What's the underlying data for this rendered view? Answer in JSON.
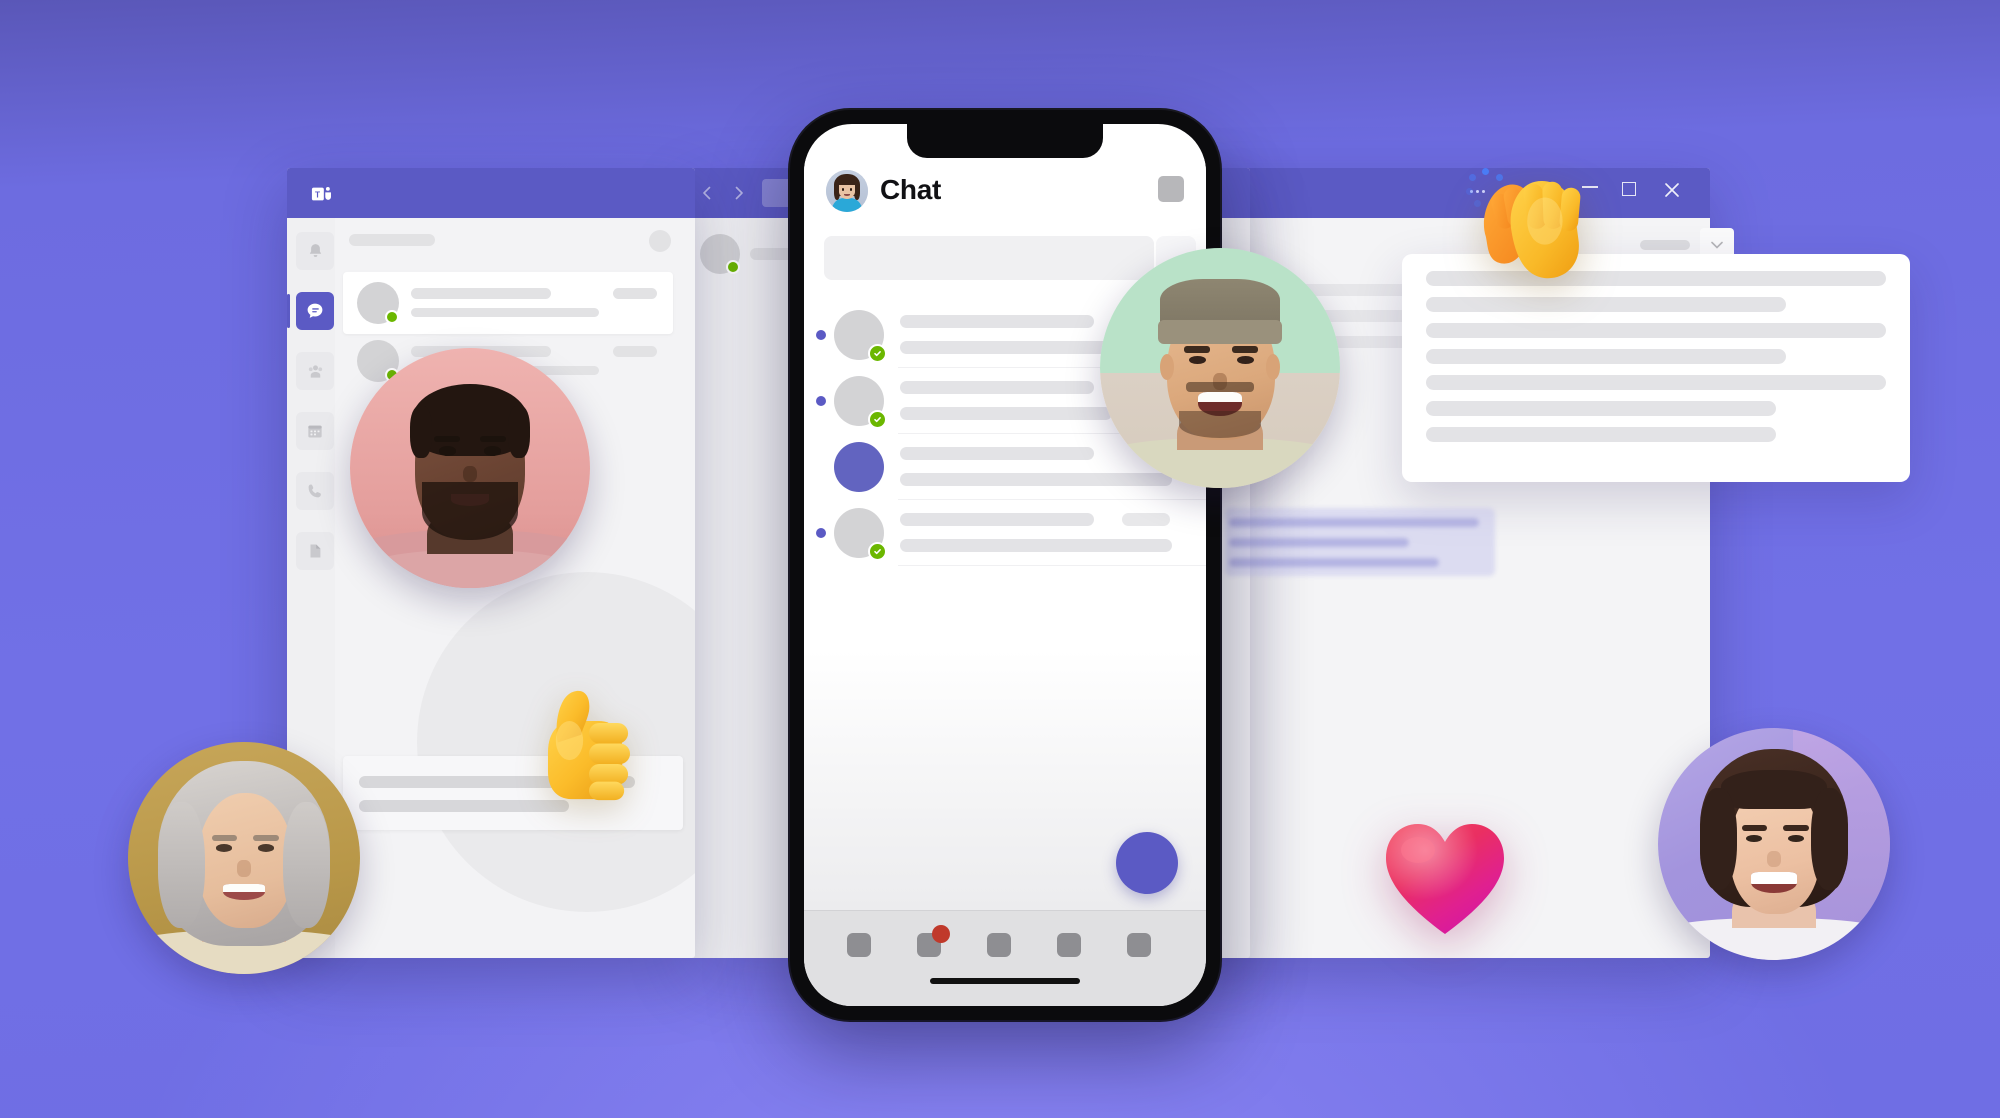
{
  "meta": {
    "scene_title": "Microsoft Teams chat across desktop and mobile",
    "background_color_top": "#5a57b8",
    "background_color_main": "#7170e6",
    "accent_purple": "#5b5ac4",
    "presence_green": "#6bb700",
    "badge_red": "#c0392b"
  },
  "desktop_window": {
    "titlebar": {
      "app_logo_name": "microsoft-teams-logo",
      "back_label": "‹",
      "forward_label": "›",
      "search_placeholder": "",
      "more_options_label": "···",
      "minimize_label": "—",
      "maximize_label": "□",
      "close_label": "✕"
    },
    "app_rail": [
      {
        "name": "activity",
        "icon": "bell-icon",
        "active": false
      },
      {
        "name": "chat",
        "icon": "chat-icon",
        "active": true
      },
      {
        "name": "teams",
        "icon": "people-icon",
        "active": false
      },
      {
        "name": "calendar",
        "icon": "calendar-icon",
        "active": false
      },
      {
        "name": "calls",
        "icon": "phone-icon",
        "active": false
      },
      {
        "name": "files",
        "icon": "file-icon",
        "active": false
      }
    ],
    "chat_list": [
      {
        "selected": true,
        "presence": "available",
        "has_timestamp": true
      },
      {
        "selected": false,
        "presence": "available",
        "has_timestamp": true
      },
      {
        "selected": false,
        "presence": "available",
        "has_timestamp": false
      }
    ]
  },
  "second_window": {
    "header_presence": "available"
  },
  "right_window": {
    "card_lines": [
      460,
      360,
      460,
      360,
      460,
      350,
      350
    ]
  },
  "phone": {
    "header": {
      "avatar_name": "profile-avatar",
      "title": "Chat",
      "action_icon": "new-chat-icon"
    },
    "search": {
      "placeholder": "",
      "filter_icon": "filter-icon"
    },
    "chat_list": [
      {
        "unread": true,
        "presence": "available",
        "avatar_style": "grey",
        "timestamp": false
      },
      {
        "unread": true,
        "presence": "available",
        "avatar_style": "grey",
        "timestamp": false
      },
      {
        "unread": false,
        "presence": "none",
        "avatar_style": "accent",
        "timestamp": false
      },
      {
        "unread": true,
        "presence": "available",
        "avatar_style": "grey",
        "timestamp": true
      }
    ],
    "fab": {
      "name": "new-chat-fab"
    },
    "tabbar": [
      {
        "name": "activity-tab",
        "badge": null
      },
      {
        "name": "chat-tab",
        "badge": "unread"
      },
      {
        "name": "teams-tab",
        "badge": null
      },
      {
        "name": "calendar-tab",
        "badge": null
      },
      {
        "name": "more-tab",
        "badge": null
      }
    ],
    "home_indicator": true
  },
  "people": [
    {
      "id": "person-man-pink",
      "description": "Smiling man in pink sweater",
      "bg": "#e8a6a4"
    },
    {
      "id": "person-man-beanie",
      "description": "Smiling man wearing a beanie hat",
      "bg": "#bfe3cc"
    },
    {
      "id": "person-senior-woman",
      "description": "Smiling senior woman, grey curls",
      "bg": "#bb9a4f"
    },
    {
      "id": "person-short-hair",
      "description": "Smiling person with short dark hair",
      "bg": "#a79ae0"
    }
  ],
  "reactions": [
    {
      "id": "thumbs-up-emoji",
      "glyph": "👍",
      "label": "Thumbs up"
    },
    {
      "id": "clapping-hands-emoji",
      "glyph": "👏",
      "label": "Clapping hands"
    },
    {
      "id": "heart-emoji",
      "glyph": "❤️",
      "label": "Heart"
    }
  ]
}
